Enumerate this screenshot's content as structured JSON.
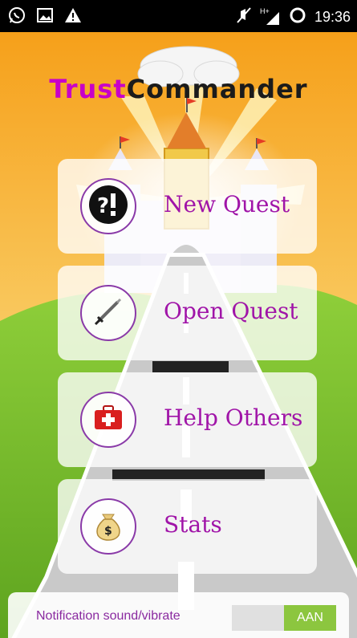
{
  "status_bar": {
    "time": "19:36",
    "left_icons": [
      "whatsapp-icon",
      "image-icon",
      "warning-icon"
    ],
    "right_icons": [
      "mute-icon",
      "signal-hplus-icon",
      "sync-icon"
    ],
    "network_label": "H+"
  },
  "app": {
    "title_part1": "Trust",
    "title_part2": "Commander"
  },
  "menu": {
    "items": [
      {
        "label": "New Quest",
        "icon": "question-exclamation-icon"
      },
      {
        "label": "Open Quest",
        "icon": "sword-icon"
      },
      {
        "label": "Help Others",
        "icon": "first-aid-kit-icon"
      },
      {
        "label": "Stats",
        "icon": "money-bag-icon"
      }
    ]
  },
  "notification": {
    "label": "Notification sound/vibrate",
    "toggle_on_label": "AAN",
    "state": "on"
  },
  "colors": {
    "accent_purple": "#a014a8",
    "title_magenta": "#c800c8",
    "toggle_green": "#8cc63f",
    "sky_orange": "#f3a31a",
    "grass_green": "#7fbf2a"
  }
}
